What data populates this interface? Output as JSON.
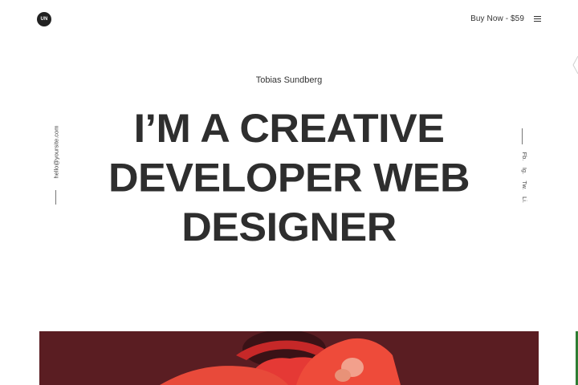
{
  "header": {
    "logo_text": "UN",
    "buy_label": "Buy Now - $59",
    "menu_icon": "hamburger-menu-icon"
  },
  "hero": {
    "author": "Tobias Sundberg",
    "lines": [
      "I’M A CREATIVE",
      "DEVELOPER WEB",
      "DESIGNER"
    ]
  },
  "side": {
    "email": "hello@yoursite.com",
    "social": [
      "Fb.",
      "Ig.",
      "Tw.",
      "Li."
    ]
  },
  "colors": {
    "text": "#2e2e2e",
    "photo_background": "#5a1d22",
    "figure_red": "#e53935",
    "accent_green": "#2e7d32"
  }
}
